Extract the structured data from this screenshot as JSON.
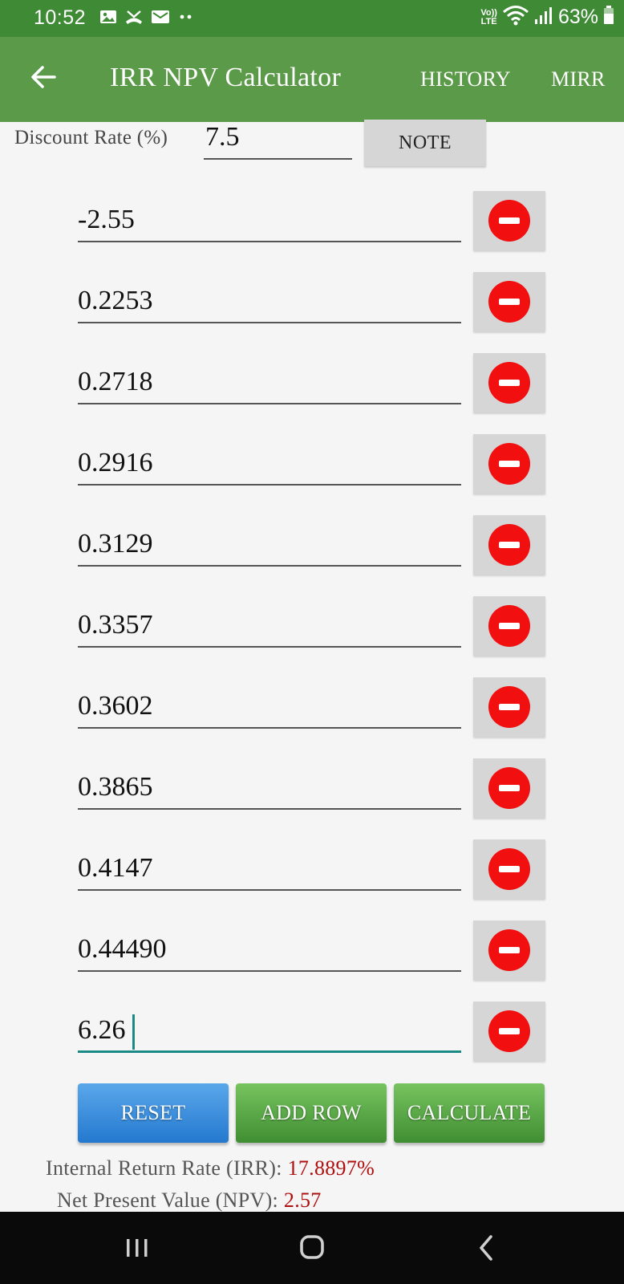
{
  "status_bar": {
    "time": "10:52",
    "network_label_top": "Vo))",
    "network_label_bottom": "LTE",
    "battery_percent": "63%",
    "left_icons": [
      "image-icon",
      "missed-call-icon",
      "mail-icon",
      "more-dots-icon"
    ],
    "right_icons": [
      "wifi-icon",
      "signal-icon",
      "battery-icon"
    ]
  },
  "app_bar": {
    "title": "IRR NPV Calculator",
    "history_label": "HISTORY",
    "mirr_label": "MIRR",
    "back_icon": "back-arrow-icon",
    "background": "#5b9a48"
  },
  "discount": {
    "label": "Discount Rate (%)",
    "value": "7.5",
    "note_label": "NOTE"
  },
  "cash_flows": [
    "-2.55",
    "0.2253",
    "0.2718",
    "0.2916",
    "0.3129",
    "0.3357",
    "0.3602",
    "0.3865",
    "0.4147",
    "0.44490",
    "6.26"
  ],
  "active_row_index": 10,
  "remove_icon": "remove-circle-icon",
  "buttons": {
    "reset": "RESET",
    "add_row": "ADD ROW",
    "calculate": "CALCULATE"
  },
  "results": {
    "irr_label": "Internal Return Rate (IRR)",
    "irr_value": "17.8897%",
    "npv_label": "Net Present Value (NPV)",
    "npv_value": "2.57",
    "separator": ":"
  },
  "colors": {
    "status_bar": "#3f8a35",
    "app_bar": "#5b9a48",
    "reset_button": "#2f86d8",
    "green_button": "#56a544",
    "remove_icon": "#f20f0f",
    "result_value": "#b00f0f",
    "active_underline": "#1b8a87"
  },
  "nav_bar": {
    "icons": [
      "recent-apps-icon",
      "home-icon",
      "back-icon"
    ]
  }
}
